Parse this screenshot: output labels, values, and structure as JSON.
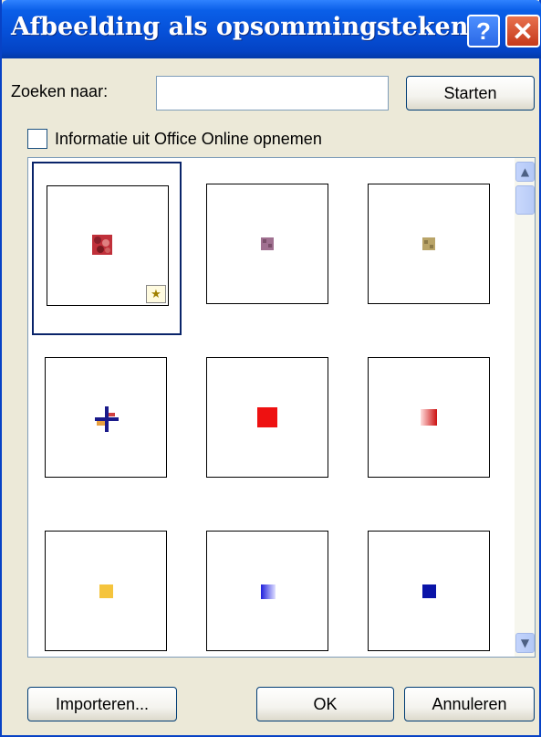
{
  "dialog": {
    "title": "Afbeelding als opsommingsteken",
    "help_glyph": "?",
    "close_glyph": "✕"
  },
  "search": {
    "label": "Zoeken naar:",
    "value": "",
    "start_label": "Starten"
  },
  "office_online": {
    "label": "Informatie uit Office Online opnemen",
    "checked": false
  },
  "gallery": {
    "selected_index": 0,
    "items": [
      {
        "icon": "red-floral-textured-bullet-icon",
        "colors": [
          "#c0303a",
          "#8a1f2a",
          "#e08080"
        ]
      },
      {
        "icon": "mauve-textured-bullet-icon",
        "colors": [
          "#a07090",
          "#7a4f6a"
        ]
      },
      {
        "icon": "tan-textured-bullet-icon",
        "colors": [
          "#b9a468",
          "#8c7a48"
        ]
      },
      {
        "icon": "cross-bullet-icon",
        "colors": [
          "#1a1a8a",
          "#e8a040"
        ]
      },
      {
        "icon": "red-square-bullet-icon",
        "colors": [
          "#ee1111"
        ]
      },
      {
        "icon": "red-gradient-square-bullet-icon",
        "colors": [
          "#cc1111",
          "#ffdede"
        ]
      },
      {
        "icon": "yellow-square-bullet-icon",
        "colors": [
          "#f5c43d"
        ]
      },
      {
        "icon": "blue-gradient-square-bullet-icon",
        "colors": [
          "#2020dd",
          "#e0e0ff"
        ]
      },
      {
        "icon": "navy-square-bullet-icon",
        "colors": [
          "#0a14a8"
        ]
      }
    ],
    "scroll_up_glyph": "▲",
    "scroll_down_glyph": "▼"
  },
  "actions": {
    "import_label": "Importeren...",
    "ok_label": "OK",
    "cancel_label": "Annuleren"
  }
}
